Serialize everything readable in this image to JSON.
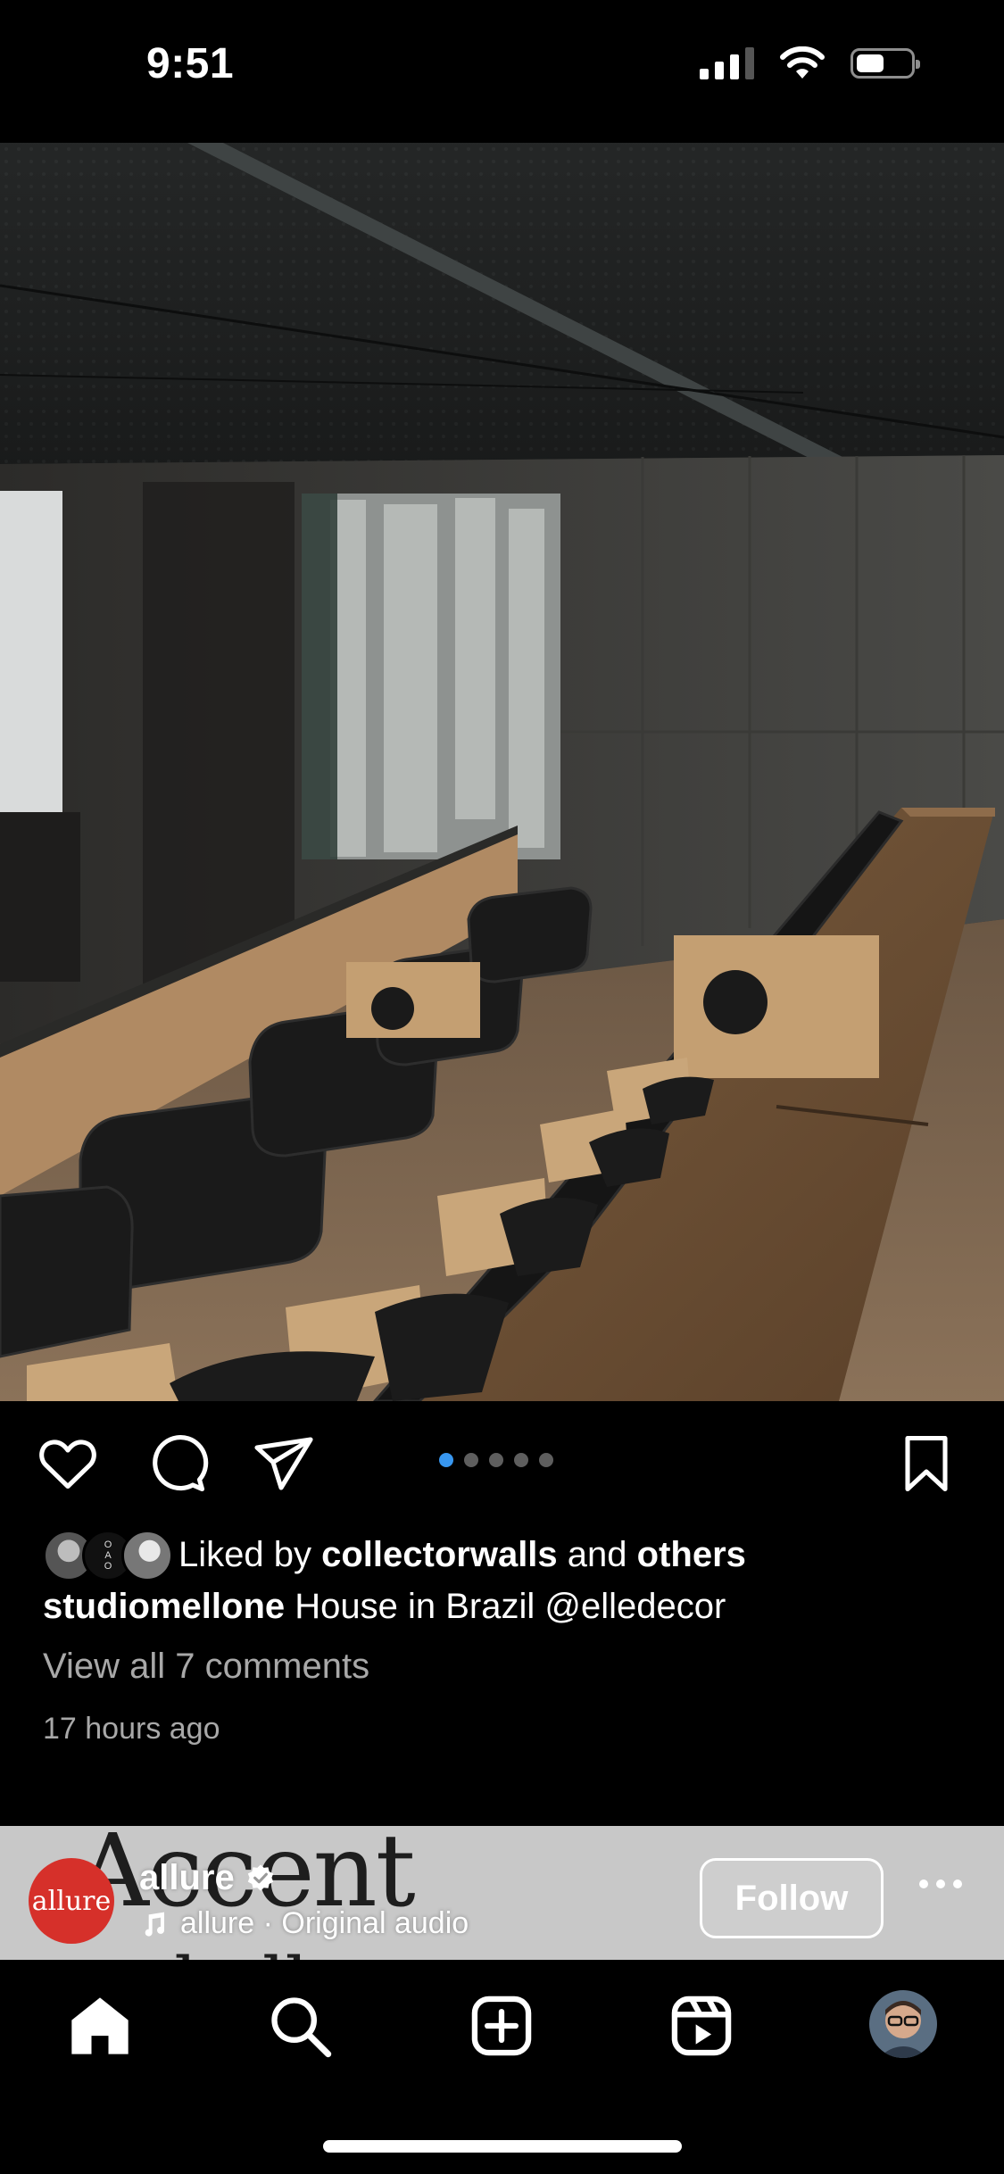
{
  "status_bar": {
    "time": "9:51"
  },
  "post": {
    "image_alt": "Home theater with black leather seats and wood desk",
    "carousel": {
      "count": 5,
      "active_index": 0
    },
    "liked_by_prefix": "Liked by",
    "liked_by_user": "collectorwalls",
    "liked_by_connector": "and",
    "liked_by_others": "others",
    "caption_user": "studiomellone",
    "caption_text": "House in Brazil @elledecor",
    "view_comments": "View all 7 comments",
    "time_ago": "17 hours ago"
  },
  "next_post": {
    "avatar_text": "allure",
    "username": "allure",
    "audio": "allure · Original audio",
    "follow_label": "Follow",
    "background_text_1": "Accent",
    "background_text_2": "challenge"
  },
  "tab_bar": {
    "items": [
      "home-icon",
      "search-icon",
      "create-icon",
      "reels-icon",
      "profile-avatar"
    ]
  },
  "colors": {
    "background": "#000000",
    "carousel_active": "#3897f0",
    "muted_text": "#a8a8a8",
    "allure_red": "#d6302a"
  }
}
